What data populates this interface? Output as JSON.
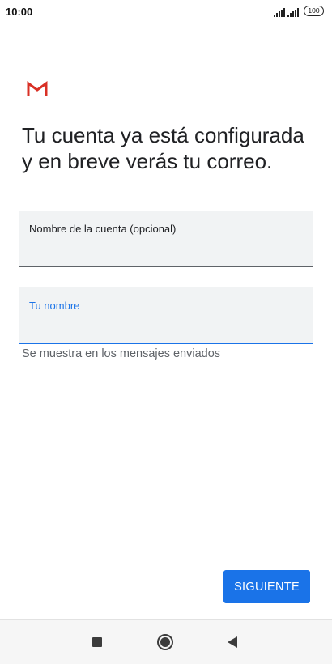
{
  "status_bar": {
    "time": "10:00",
    "battery": "100",
    "icons": [
      "signal-icon",
      "signal-icon",
      "battery-icon"
    ]
  },
  "app": {
    "logo_icon": "gmail-logo-icon",
    "brand_color": "#d93025",
    "accent_color": "#1a73e8"
  },
  "headline": "Tu cuenta ya está configurada y en breve verás tu correo.",
  "form": {
    "account_name": {
      "label": "Nombre de la cuenta (opcional)",
      "value": ""
    },
    "your_name": {
      "label": "Tu nombre",
      "value": "",
      "focused": true,
      "helper": "Se muestra en los mensajes enviados"
    }
  },
  "actions": {
    "next_label": "SIGUIENTE"
  },
  "nav_bar": {
    "icons": [
      "recent-apps-icon",
      "home-icon",
      "back-icon"
    ]
  }
}
